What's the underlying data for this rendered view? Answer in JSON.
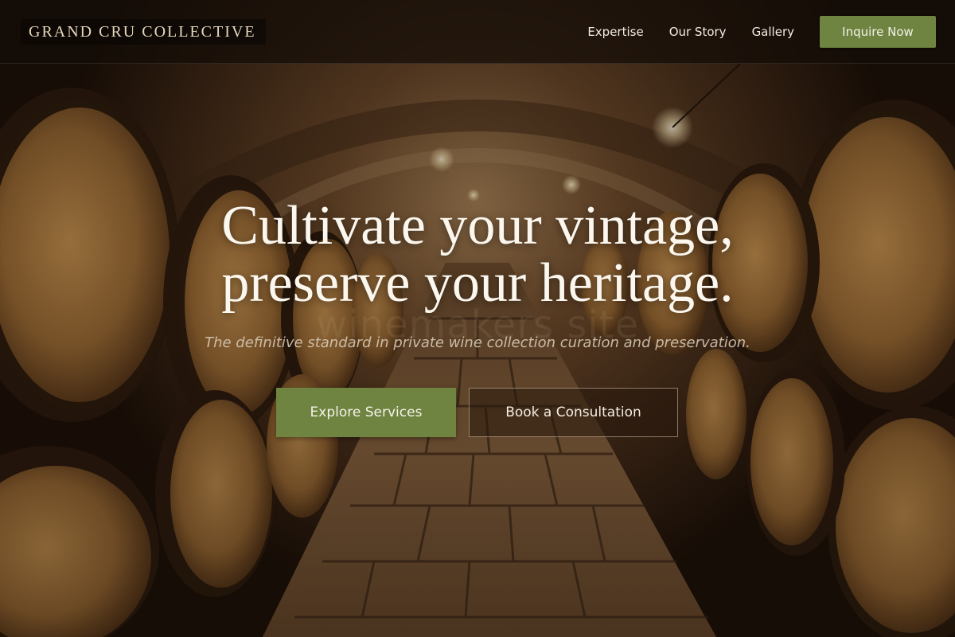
{
  "nav": {
    "brand": "GRAND CRU COLLECTIVE",
    "links": [
      {
        "label": "Expertise"
      },
      {
        "label": "Our Story"
      },
      {
        "label": "Gallery"
      }
    ],
    "cta_label": "Inquire Now"
  },
  "hero": {
    "headline_line1": "Cultivate your vintage,",
    "headline_line2": "preserve your heritage.",
    "watermark": "winemakers site",
    "subtitle": "The definitive standard in private wine collection curation and preservation.",
    "primary_cta": "Explore Services",
    "secondary_cta": "Book a Consultation"
  },
  "colors": {
    "accent_green": "#6f8440",
    "cream_text": "#fbf7ef",
    "nav_background": "#140d07"
  },
  "background": {
    "scene": "wine-cellar-barrels-photo"
  }
}
